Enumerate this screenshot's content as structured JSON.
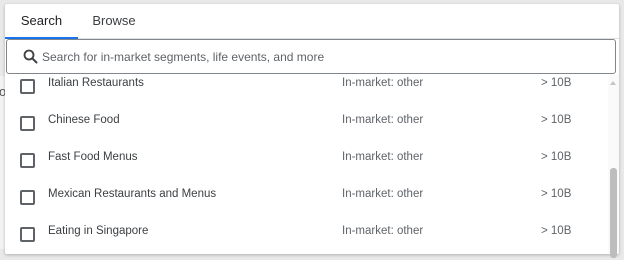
{
  "backdrop": {
    "partial_text": "ol"
  },
  "tabs": [
    {
      "label": "Search",
      "active": true
    },
    {
      "label": "Browse",
      "active": false
    }
  ],
  "search": {
    "placeholder": "Search for in-market segments, life events, and more",
    "value": ""
  },
  "rows": [
    {
      "name": "Italian Restaurants",
      "type": "In-market: other",
      "size": "> 10B",
      "checked": false
    },
    {
      "name": "Chinese Food",
      "type": "In-market: other",
      "size": "> 10B",
      "checked": false
    },
    {
      "name": "Fast Food Menus",
      "type": "In-market: other",
      "size": "> 10B",
      "checked": false
    },
    {
      "name": "Mexican Restaurants and Menus",
      "type": "In-market: other",
      "size": "> 10B",
      "checked": false
    },
    {
      "name": "Eating in Singapore",
      "type": "In-market: other",
      "size": "> 10B",
      "checked": false
    }
  ],
  "colors": {
    "accent": "#1a73e8",
    "text": "#3c4043",
    "muted": "#5f6368"
  },
  "icons": {
    "search": "search-icon",
    "checkbox": "checkbox-unchecked-icon",
    "scroll_up": "chevron-up-icon"
  }
}
